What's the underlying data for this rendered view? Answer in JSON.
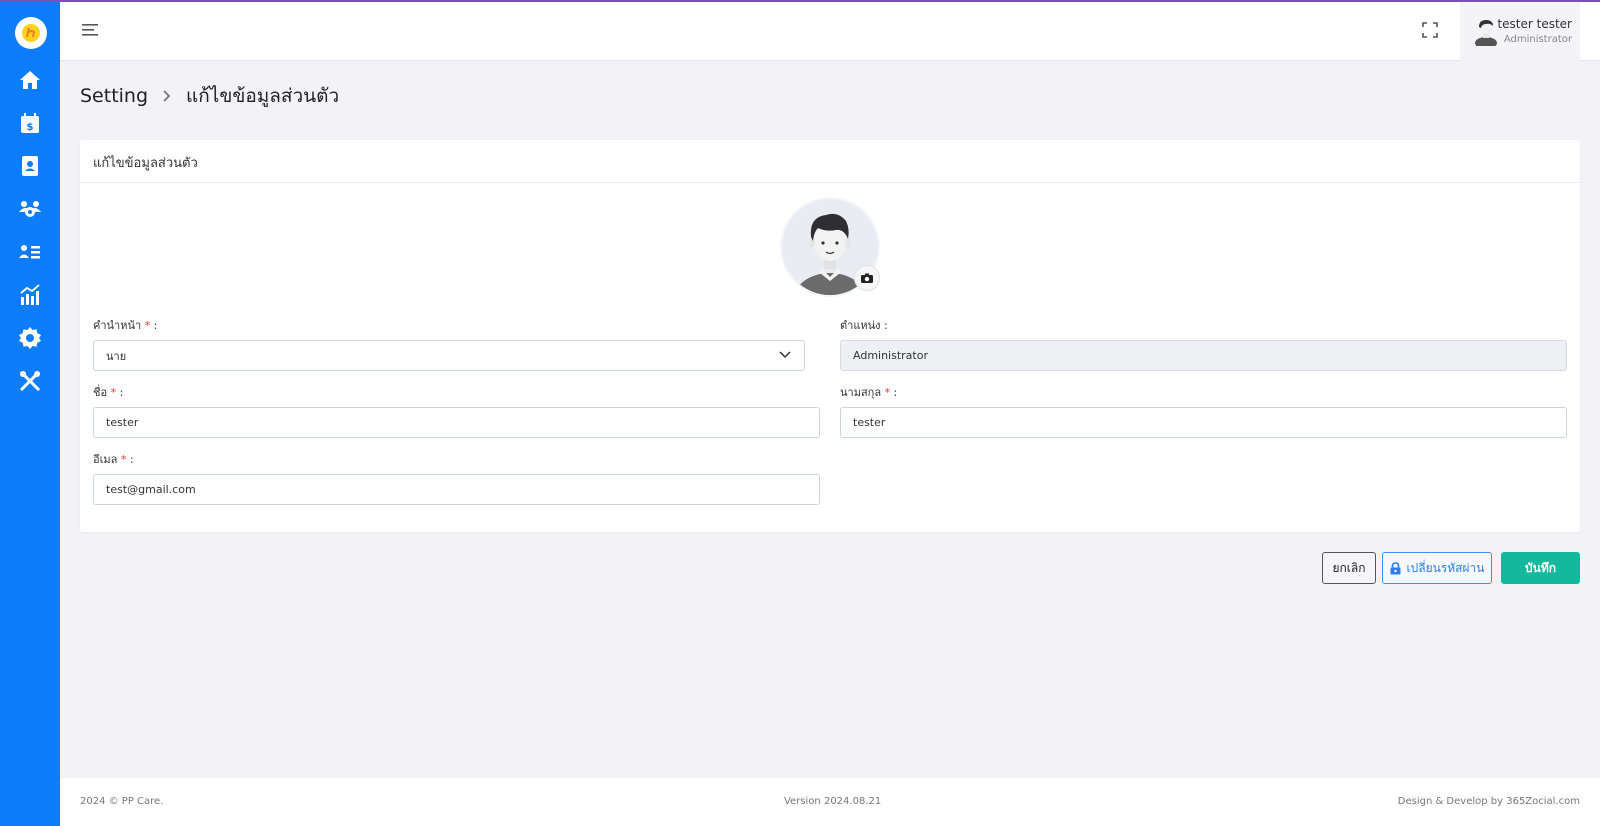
{
  "header": {
    "user_name": "tester tester",
    "user_role": "Administrator"
  },
  "breadcrumb": {
    "parent": "Setting",
    "current": "แก้ไขข้อมูลส่วนตัว"
  },
  "card": {
    "title": "แก้ไขข้อมูลส่วนตัว"
  },
  "form": {
    "prefix_label": "คำนำหน้า",
    "prefix_value": "นาย",
    "position_label": "ตำแหน่ง :",
    "position_value": "Administrator",
    "firstname_label": "ชื่อ",
    "firstname_value": "tester",
    "lastname_label": "นามสกุล",
    "lastname_value": "tester",
    "email_label": "อีเมล",
    "email_value": "test@gmail.com",
    "required_mark": "*",
    "colon": " :"
  },
  "buttons": {
    "cancel": "ยกเลิก",
    "change_password": "เปลี่ยนรหัสผ่าน",
    "save": "บันทึก"
  },
  "footer": {
    "copyright": "2024 © PP Care.",
    "version": "Version 2024.08.21",
    "credit": "Design & Develop by 365Zocial.com"
  },
  "sidebar": {
    "items": [
      "home-icon",
      "calendar-dollar-icon",
      "contacts-icon",
      "users-gear-icon",
      "user-list-icon",
      "chart-icon",
      "gear-icon",
      "tools-icon"
    ]
  },
  "colors": {
    "sidebar": "#0d7dfd",
    "primary": "#2f7ef0",
    "save": "#14b89c",
    "required": "#e53935"
  }
}
